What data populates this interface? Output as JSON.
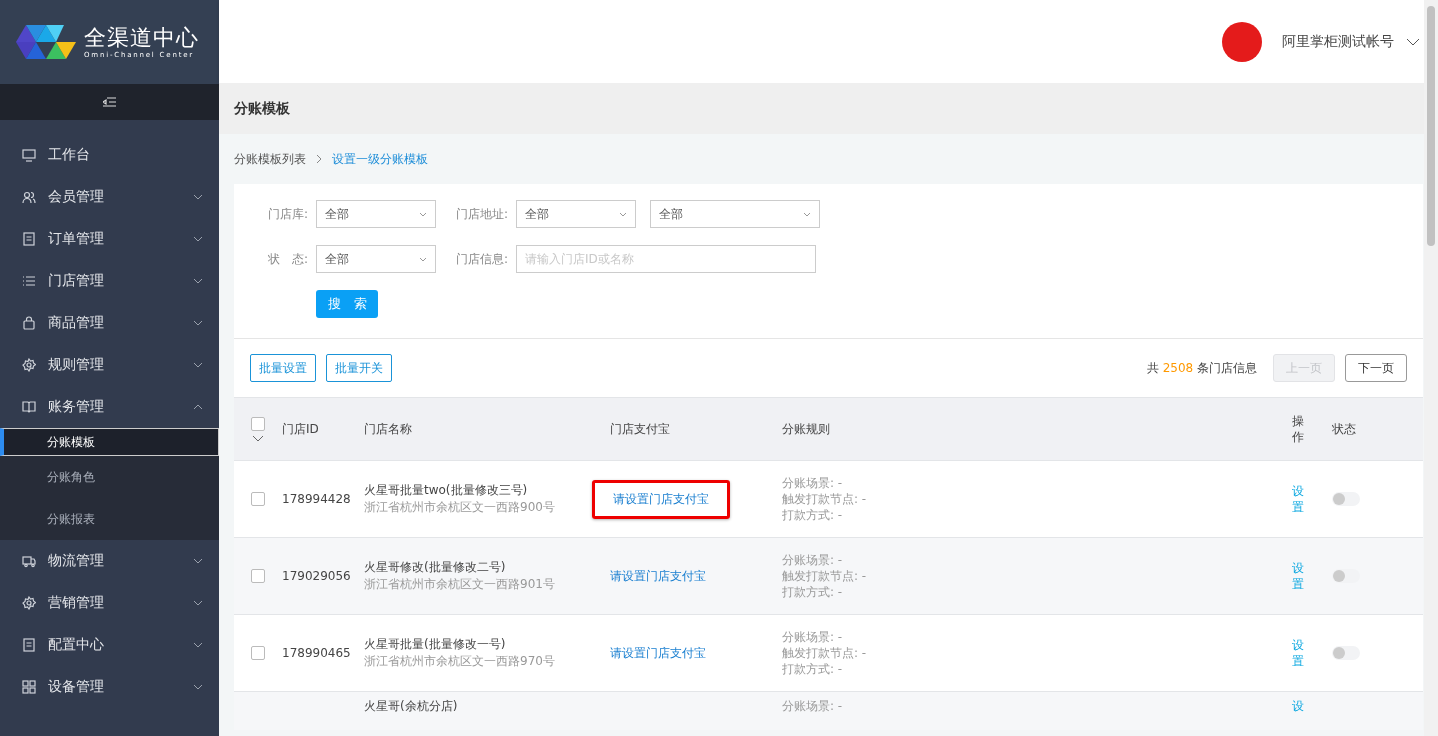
{
  "logo": {
    "title": "全渠道中心",
    "subtitle": "Omni-Channel Center"
  },
  "user": {
    "name": "阿里掌柜测试帐号"
  },
  "sidebar": {
    "items": [
      {
        "label": "工作台",
        "expandable": false
      },
      {
        "label": "会员管理",
        "expandable": true,
        "expanded": false
      },
      {
        "label": "订单管理",
        "expandable": true,
        "expanded": false
      },
      {
        "label": "门店管理",
        "expandable": true,
        "expanded": false
      },
      {
        "label": "商品管理",
        "expandable": true,
        "expanded": false
      },
      {
        "label": "规则管理",
        "expandable": true,
        "expanded": false
      },
      {
        "label": "账务管理",
        "expandable": true,
        "expanded": true,
        "children": [
          {
            "label": "分账模板",
            "selected": true
          },
          {
            "label": "分账角色",
            "selected": false
          },
          {
            "label": "分账报表",
            "selected": false
          }
        ]
      },
      {
        "label": "物流管理",
        "expandable": true,
        "expanded": false
      },
      {
        "label": "营销管理",
        "expandable": true,
        "expanded": false
      },
      {
        "label": "配置中心",
        "expandable": true,
        "expanded": false
      },
      {
        "label": "设备管理",
        "expandable": true,
        "expanded": false
      }
    ]
  },
  "page_title": "分账模板",
  "breadcrumb": [
    {
      "label": "分账模板列表",
      "current": false
    },
    {
      "label": "设置一级分账模板",
      "current": true
    }
  ],
  "filters": {
    "store_lib": {
      "label": "门店库:",
      "value": "全部"
    },
    "address": {
      "label": "门店地址:",
      "values": [
        "全部",
        "全部"
      ]
    },
    "status": {
      "label": "状　态:",
      "value": "全部"
    },
    "info": {
      "label": "门店信息:",
      "placeholder": "请输入门店ID或名称"
    },
    "search_button": "搜　索"
  },
  "toolbar": {
    "buttons": [
      "批量设置",
      "批量开关"
    ],
    "total_prefix": "共",
    "total": "2508",
    "total_suffix": "条门店信息",
    "prev": {
      "label": "上一页",
      "disabled": true
    },
    "next": {
      "label": "下一页",
      "disabled": false
    }
  },
  "table": {
    "select_all_checked": false,
    "columns": [
      "门店ID",
      "门店名称",
      "门店支付宝",
      "分账规则",
      "操作",
      "状态"
    ],
    "rows": [
      {
        "id": "178994428",
        "name": "火星哥批量two(批量修改三号)",
        "address": "浙江省杭州市余杭区文一西路900号",
        "alipay": "请设置门店支付宝",
        "highlighted": true,
        "rules": [
          "分账场景: -",
          "触发打款节点: -",
          "打款方式: -"
        ],
        "action": "设置",
        "checked": false,
        "on": false
      },
      {
        "id": "179029056",
        "name": "火星哥修改(批量修改二号)",
        "address": "浙江省杭州市余杭区文一西路901号",
        "alipay": "请设置门店支付宝",
        "highlighted": false,
        "rules": [
          "分账场景: -",
          "触发打款节点: -",
          "打款方式: -"
        ],
        "action": "设置",
        "checked": false,
        "on": false
      },
      {
        "id": "178990465",
        "name": "火星哥批量(批量修改一号)",
        "address": "浙江省杭州市余杭区文一西路970号",
        "alipay": "请设置门店支付宝",
        "highlighted": false,
        "rules": [
          "分账场景: -",
          "触发打款节点: -",
          "打款方式: -"
        ],
        "action": "设置",
        "checked": false,
        "on": false
      },
      {
        "name": "火星哥(余杭分店)",
        "rules": [
          "分账场景: -"
        ],
        "action": "设"
      }
    ]
  }
}
